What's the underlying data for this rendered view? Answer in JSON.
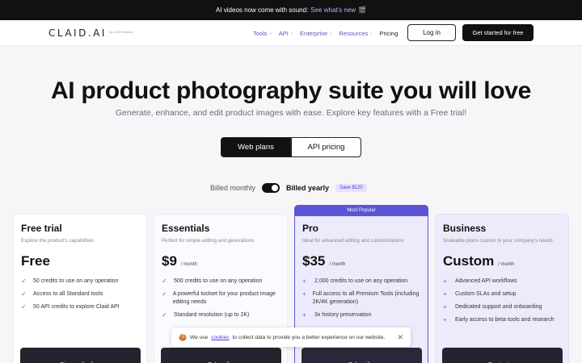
{
  "announcement": {
    "text": "AI videos now come with sound:",
    "link": "See what's new",
    "emoji": "🎬"
  },
  "nav": {
    "logo": "CLAID.AI",
    "logo_sub": "by Let's Enhance",
    "links": [
      {
        "label": "Tools",
        "dropdown": true
      },
      {
        "label": "API",
        "dropdown": true
      },
      {
        "label": "Enterprise",
        "dropdown": true
      },
      {
        "label": "Resources",
        "dropdown": true
      },
      {
        "label": "Pricing",
        "dropdown": false
      }
    ],
    "login": "Log in",
    "get_started": "Get started for free"
  },
  "hero": {
    "title": "AI product photography suite you will love",
    "subtitle": "Generate, enhance, and edit product images with ease. Explore key features with a Free trial!"
  },
  "plan_tabs": {
    "web": "Web plans",
    "api": "API pricing"
  },
  "billing": {
    "monthly": "Billed monthly",
    "yearly": "Billed yearly",
    "save": "Save $120"
  },
  "plans": [
    {
      "name": "Free trial",
      "desc": "Explore the product's capabilities",
      "price": "Free",
      "per": "",
      "features": [
        "50 credits to use on any operation",
        "Access to all Standard tools",
        "50 API credits to explore Claid API"
      ],
      "cta": "Sign up for free"
    },
    {
      "name": "Essentials",
      "desc": "Perfect for simple editing and generations",
      "price": "$9",
      "per": "/ month",
      "features": [
        "500 credits to use on any operation",
        "A powerful toolset for your product image editing needs",
        "Standard resolution (up to 2K)"
      ],
      "cta": "Subscribe"
    },
    {
      "name": "Pro",
      "badge": "Most Popular",
      "desc": "Ideal for advanced editing and customizations",
      "price": "$35",
      "per": "/ month",
      "features": [
        "2,000 credits to use on any operation",
        "Full access to all Premium Tools (including 2K/4K generation)",
        "3x history preservation"
      ],
      "cta": "Subscribe"
    },
    {
      "name": "Business",
      "desc": "Scaleable plans custom to your company's needs",
      "price": "Custom",
      "per": "/ month",
      "features": [
        "Advanced API workflows",
        "Custom SLAs and setup",
        "Dedicated support and onboarding",
        "Early access to beta tools and research"
      ],
      "cta": "Contact us"
    }
  ],
  "cookie": {
    "icon": "🍪",
    "pre": "We use",
    "link": "cookies",
    "post": "to collect data to provide you a better experience on our website."
  },
  "colors": {
    "accent": "#5b55d6",
    "dark": "#111111",
    "badge_bg": "#e4e2ff"
  }
}
